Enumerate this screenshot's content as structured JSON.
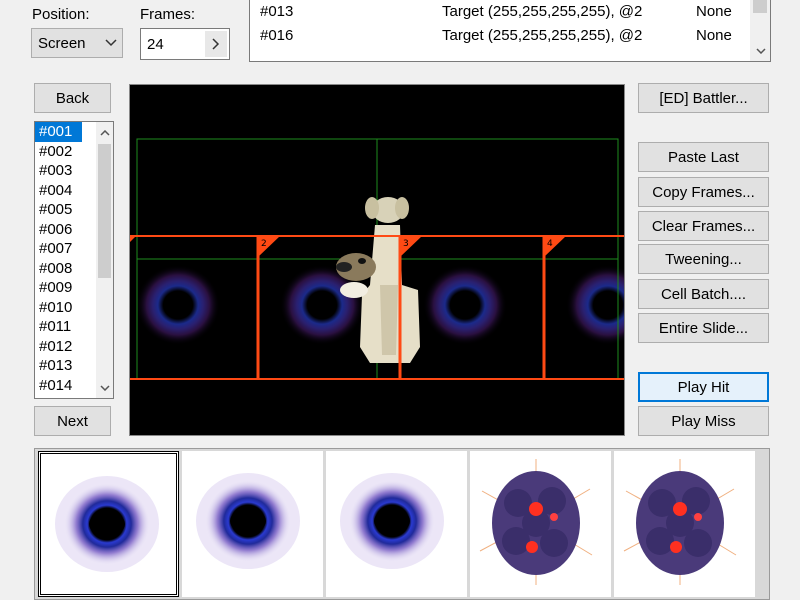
{
  "position": {
    "label": "Position:",
    "value": "Screen"
  },
  "frames": {
    "label": "Frames:",
    "value": "24"
  },
  "timings": [
    {
      "id": "#013",
      "action": "Target (255,255,255,255), @2",
      "extra": "None"
    },
    {
      "id": "#016",
      "action": "Target (255,255,255,255), @2",
      "extra": "None"
    }
  ],
  "nav": {
    "back": "Back",
    "next": "Next"
  },
  "cells": [
    "#001",
    "#002",
    "#003",
    "#004",
    "#005",
    "#006",
    "#007",
    "#008",
    "#009",
    "#010",
    "#011",
    "#012",
    "#013",
    "#014"
  ],
  "canvas": {
    "cell_markers": [
      "2",
      "3",
      "4"
    ],
    "background": "#000000",
    "grid_color": "#1e8c1e",
    "marker_color": "#ff4a14"
  },
  "buttons": {
    "battler": "[ED] Battler...",
    "paste_last": "Paste Last",
    "copy_frames": "Copy Frames...",
    "clear_frames": "Clear Frames...",
    "tweening": "Tweening...",
    "cell_batch": "Cell Batch....",
    "entire_slide": "Entire Slide...",
    "play_hit": "Play Hit",
    "play_miss": "Play Miss"
  },
  "filmstrip": {
    "thumbs": [
      "blue-ring-frame",
      "blue-ring-frame",
      "blue-ring-frame",
      "purple-burst-frame",
      "purple-burst-frame"
    ],
    "selected_index": 0
  },
  "colors": {
    "selection": "#0078d7",
    "accent": "#ff4a14"
  }
}
